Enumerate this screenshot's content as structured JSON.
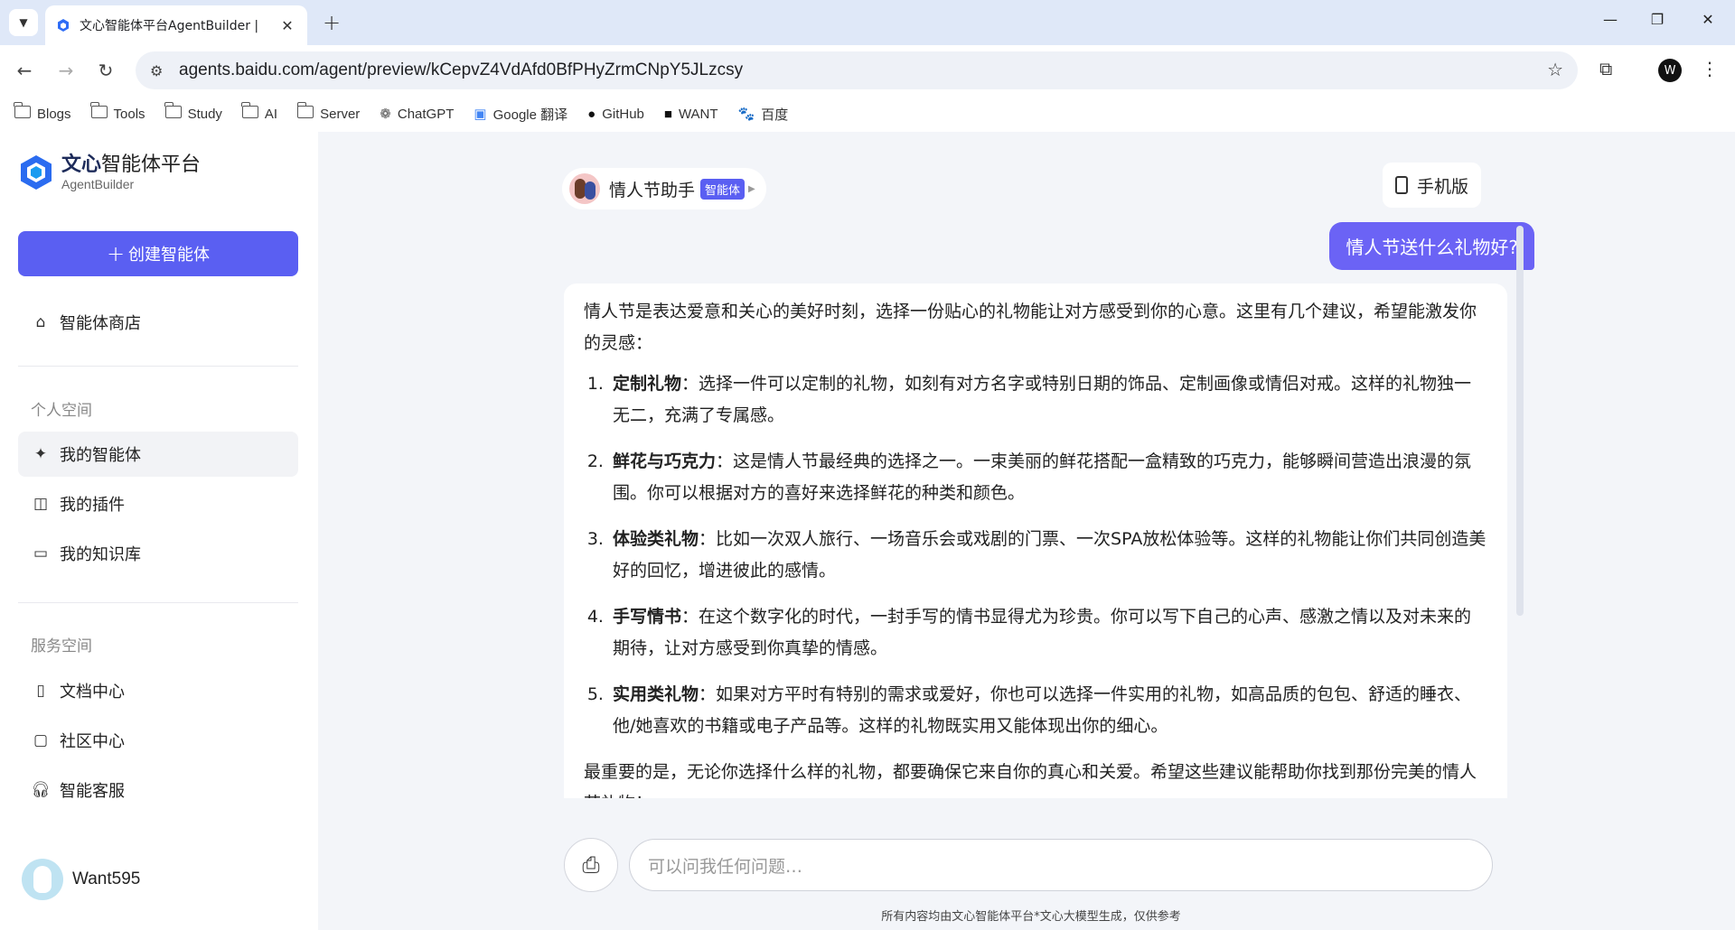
{
  "browser": {
    "tab_title": "文心智能体平台AgentBuilder |",
    "url": "agents.baidu.com/agent/preview/kCepvZ4VdAfd0BfPHyZrmCNpY5JLzcsy",
    "bookmarks": [
      {
        "label": "Blogs",
        "icon": "folder-icon"
      },
      {
        "label": "Tools",
        "icon": "folder-icon"
      },
      {
        "label": "Study",
        "icon": "folder-icon"
      },
      {
        "label": "AI",
        "icon": "folder-icon"
      },
      {
        "label": "Server",
        "icon": "folder-icon"
      },
      {
        "label": "ChatGPT",
        "icon": "chatgpt-icon"
      },
      {
        "label": "Google 翻译",
        "icon": "translate-icon"
      },
      {
        "label": "GitHub",
        "icon": "github-icon"
      },
      {
        "label": "WANT",
        "icon": "want-icon"
      },
      {
        "label": "百度",
        "icon": "baidu-icon"
      }
    ]
  },
  "sidebar": {
    "logo_title_bold": "文心",
    "logo_title_rest": "智能体平台",
    "logo_sub": "AgentBuilder",
    "create_label": "创建智能体",
    "store_label": "智能体商店",
    "personal_section": "个人空间",
    "my_agents": "我的智能体",
    "my_plugins": "我的插件",
    "my_knowledge": "我的知识库",
    "service_section": "服务空间",
    "docs": "文档中心",
    "community": "社区中心",
    "support": "智能客服",
    "username": "Want595"
  },
  "chat": {
    "agent_name": "情人节助手",
    "agent_badge": "智能体",
    "mobile_label": "手机版",
    "user_message": "情人节送什么礼物好?",
    "intro": "情人节是表达爱意和关心的美好时刻，选择一份贴心的礼物能让对方感受到你的心意。这里有几个建议，希望能激发你的灵感：",
    "items": [
      {
        "title": "定制礼物",
        "text": "：选择一件可以定制的礼物，如刻有对方名字或特别日期的饰品、定制画像或情侣对戒。这样的礼物独一无二，充满了专属感。"
      },
      {
        "title": "鲜花与巧克力",
        "text": "：这是情人节最经典的选择之一。一束美丽的鲜花搭配一盒精致的巧克力，能够瞬间营造出浪漫的氛围。你可以根据对方的喜好来选择鲜花的种类和颜色。"
      },
      {
        "title": "体验类礼物",
        "text": "：比如一次双人旅行、一场音乐会或戏剧的门票、一次SPA放松体验等。这样的礼物能让你们共同创造美好的回忆，增进彼此的感情。"
      },
      {
        "title": "手写情书",
        "text": "：在这个数字化的时代，一封手写的情书显得尤为珍贵。你可以写下自己的心声、感激之情以及对未来的期待，让对方感受到你真挚的情感。"
      },
      {
        "title": "实用类礼物",
        "text": "：如果对方平时有特别的需求或爱好，你也可以选择一件实用的礼物，如高品质的包包、舒适的睡衣、他/她喜欢的书籍或电子产品等。这样的礼物既实用又能体现出你的细心。"
      }
    ],
    "outro": "最重要的是，无论你选择什么样的礼物，都要确保它来自你的真心和关爱。希望这些建议能帮助你找到那份完美的情人节礼物！",
    "input_placeholder": "可以问我任何问题…",
    "footnote": "所有内容均由文心智能体平台*文心大模型生成，仅供参考"
  },
  "colors": {
    "accent": "#5a5ff2",
    "user_bubble": "#6b63f5",
    "main_bg": "#f3f5f9"
  }
}
